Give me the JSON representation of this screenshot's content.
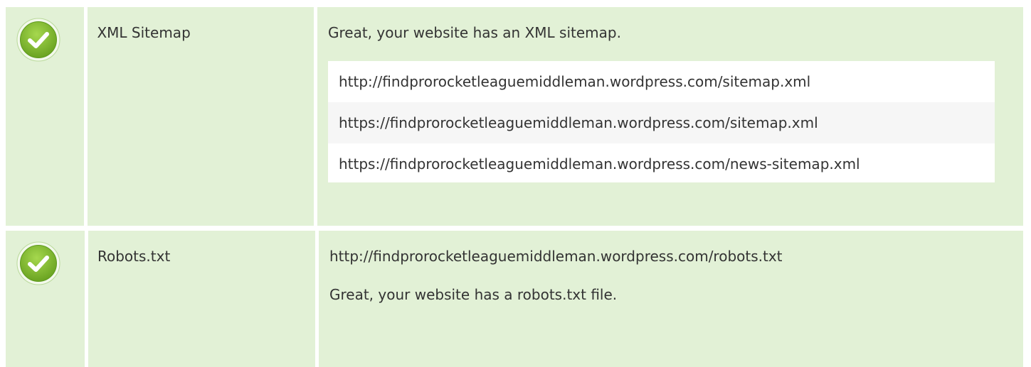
{
  "colors": {
    "row_bg": "#e2f1d6",
    "list_bg": "#ffffff",
    "list_alt_bg": "#f6f6f6",
    "check_green": "#7cbd2c",
    "check_ring": "#6aa321"
  },
  "rows": [
    {
      "status_icon": "check-circle-icon",
      "label": "XML Sitemap",
      "message": "Great, your website has an XML sitemap.",
      "urls": [
        "http://findprorocketleaguemiddleman.wordpress.com/sitemap.xml",
        "https://findprorocketleaguemiddleman.wordpress.com/sitemap.xml",
        "https://findprorocketleaguemiddleman.wordpress.com/news-sitemap.xml"
      ]
    },
    {
      "status_icon": "check-circle-icon",
      "label": "Robots.txt",
      "url": "http://findprorocketleaguemiddleman.wordpress.com/robots.txt",
      "message": "Great, your website has a robots.txt file."
    }
  ]
}
